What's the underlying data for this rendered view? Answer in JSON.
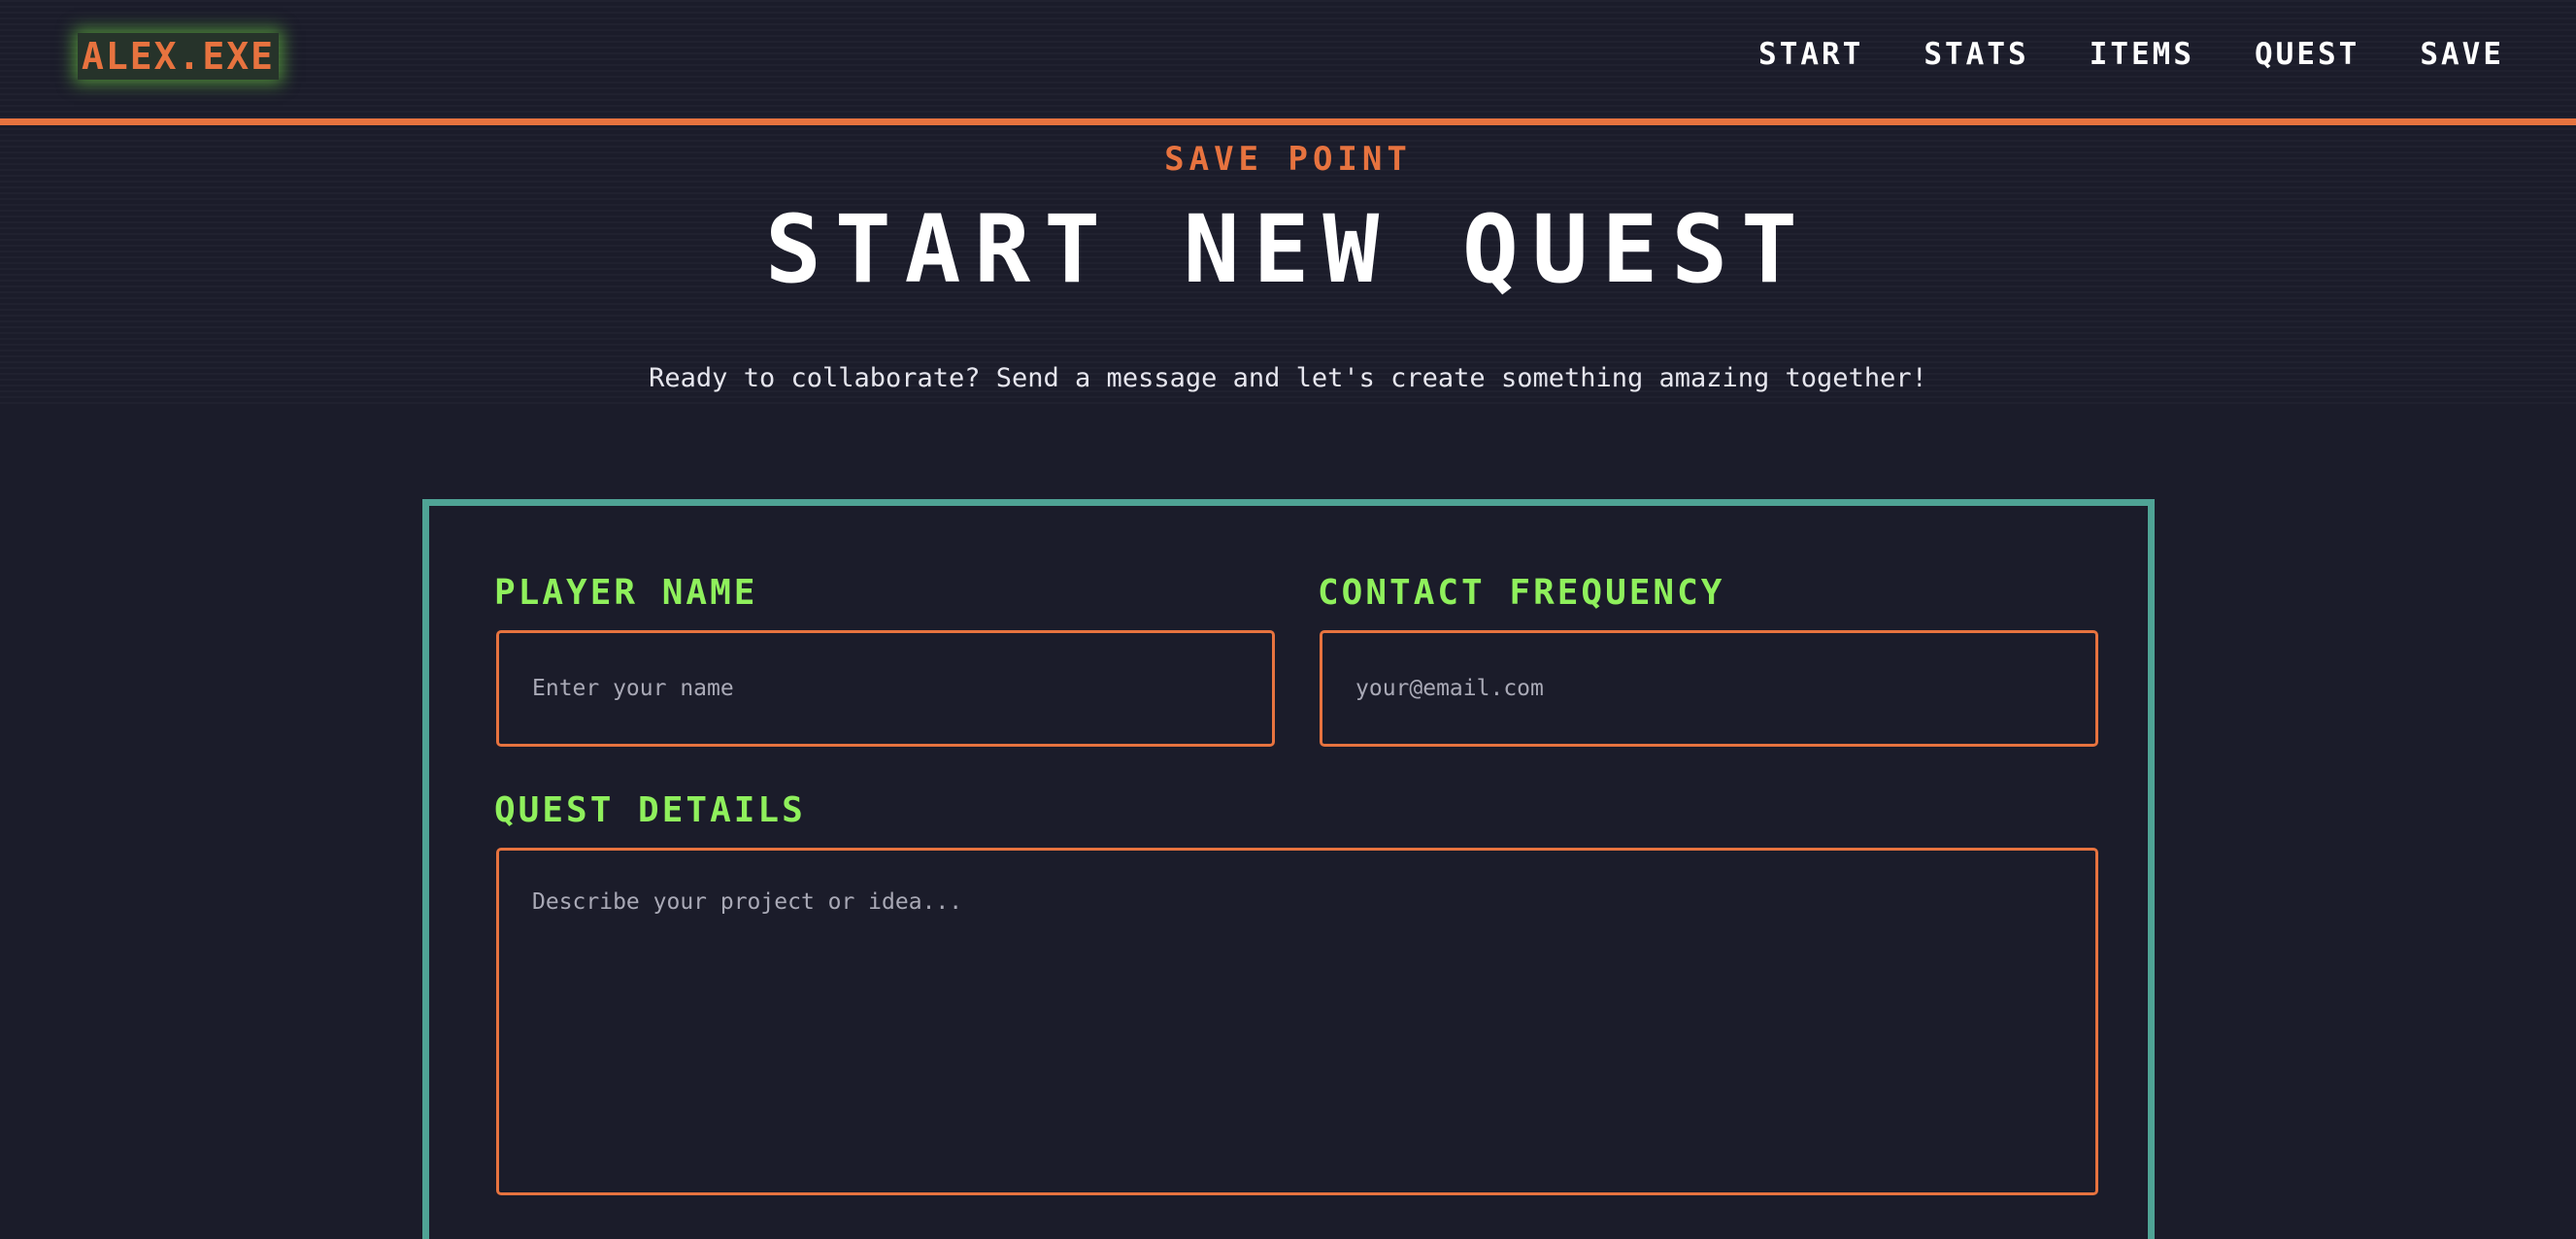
{
  "header": {
    "logo": "ALEX.EXE",
    "nav": [
      "START",
      "STATS",
      "ITEMS",
      "QUEST",
      "SAVE"
    ]
  },
  "hero": {
    "eyebrow": "SAVE POINT",
    "title": "START NEW QUEST",
    "subtitle": "Ready to collaborate? Send a message and let's create something amazing together!"
  },
  "form": {
    "name_label": "PLAYER NAME",
    "name_placeholder": "Enter your name",
    "contact_label": "CONTACT FREQUENCY",
    "contact_placeholder": "your@email.com",
    "details_label": "QUEST DETAILS",
    "details_placeholder": "Describe your project or idea..."
  },
  "colors": {
    "background": "#1b1c2a",
    "accent_orange": "#e7733f",
    "accent_green": "#8ff05c",
    "panel_border": "#4fa395",
    "text": "#ffffff"
  }
}
